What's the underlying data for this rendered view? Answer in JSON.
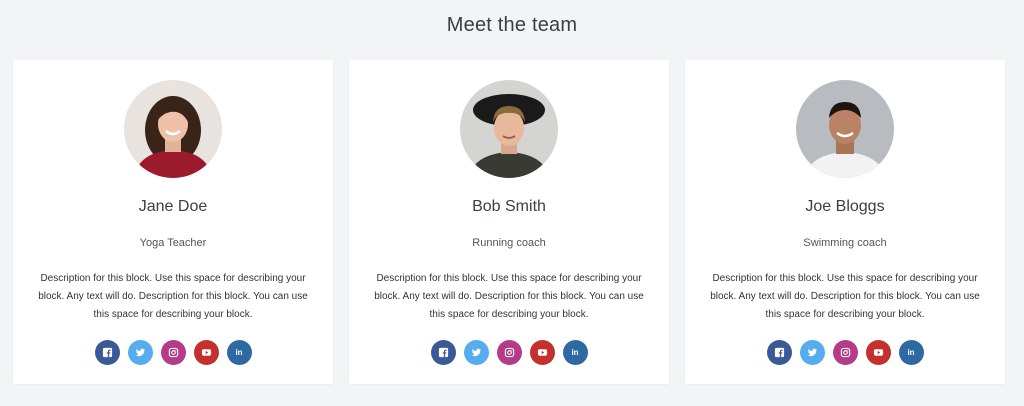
{
  "header": {
    "title": "Meet the team"
  },
  "members": [
    {
      "name": "Jane Doe",
      "role": "Yoga Teacher",
      "description": "Description for this block. Use this space for describing your block. Any text will do. Description for this block. You can use this space for describing your block."
    },
    {
      "name": "Bob Smith",
      "role": "Running coach",
      "description": "Description for this block. Use this space for describing your block. Any text will do. Description for this block. You can use this space for describing your block."
    },
    {
      "name": "Joe Bloggs",
      "role": "Swimming coach",
      "description": "Description for this block. Use this space for describing your block. Any text will do. Description for this block. You can use this space for describing your block."
    }
  ],
  "social_icons": [
    "facebook-icon",
    "twitter-icon",
    "instagram-icon",
    "youtube-icon",
    "linkedin-icon"
  ],
  "colors": {
    "facebook": "#3b5998",
    "twitter": "#55acee",
    "instagram": "#b33b87",
    "youtube": "#c4302b",
    "linkedin": "#2e6aa1",
    "background": "#f3f4f6"
  }
}
